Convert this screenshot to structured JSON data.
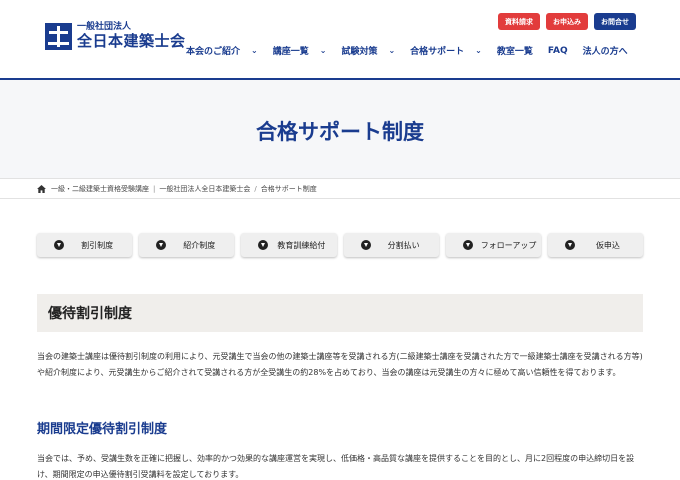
{
  "logo": {
    "sub": "一般社団法人",
    "main": "全日本建築士会"
  },
  "top_buttons": [
    {
      "label": "資料請求",
      "color": "#e23c3c"
    },
    {
      "label": "お申込み",
      "color": "#e23c3c"
    },
    {
      "label": "お問合せ",
      "color": "#1a3c8f"
    }
  ],
  "gnav": [
    {
      "label": "本会のご紹介",
      "has_dropdown": true
    },
    {
      "label": "講座一覧",
      "has_dropdown": true
    },
    {
      "label": "試験対策",
      "has_dropdown": true
    },
    {
      "label": "合格サポート",
      "has_dropdown": true
    },
    {
      "label": "教室一覧",
      "has_dropdown": false
    },
    {
      "label": "FAQ",
      "has_dropdown": false
    },
    {
      "label": "法人の方へ",
      "has_dropdown": false
    }
  ],
  "page_title": "合格サポート制度",
  "breadcrumb": [
    "一級・二級建築士資格受験講座",
    "一般社団法人全日本建築士会",
    "合格サポート制度"
  ],
  "breadcrumb_separators": [
    "|",
    "/"
  ],
  "anchors": [
    "割引制度",
    "紹介制度",
    "教育訓練給付",
    "分割払い",
    "フォローアップ",
    "仮申込"
  ],
  "section": {
    "heading": "優待割引制度",
    "para1": "当会の建築士講座は優待割引制度の利用により、元受講生で当会の他の建築士講座等を受講される方(二級建築士講座を受講された方で一級建築士講座を受講される方等)や紹介制度により、元受講生からご紹介されて受講される方が全受講生の約28%を占めており、当会の講座は元受講生の方々に極めて高い信頼性を得ております。",
    "subheading": "期間限定優待割引制度",
    "para2": "当会では、予め、受講生数を正確に把握し、効率的かつ効果的な講座運営を実現し、低価格・高品質な講座を提供することを目的とし、月に2回程度の申込締切日を設け、期間限定の申込優待割引受講料を設定しております。"
  },
  "colors": {
    "brand": "#1a3c8f",
    "accent_red": "#e23c3c",
    "title_band": "#f6f7f9",
    "section_head_bg": "#f0eeeb"
  }
}
